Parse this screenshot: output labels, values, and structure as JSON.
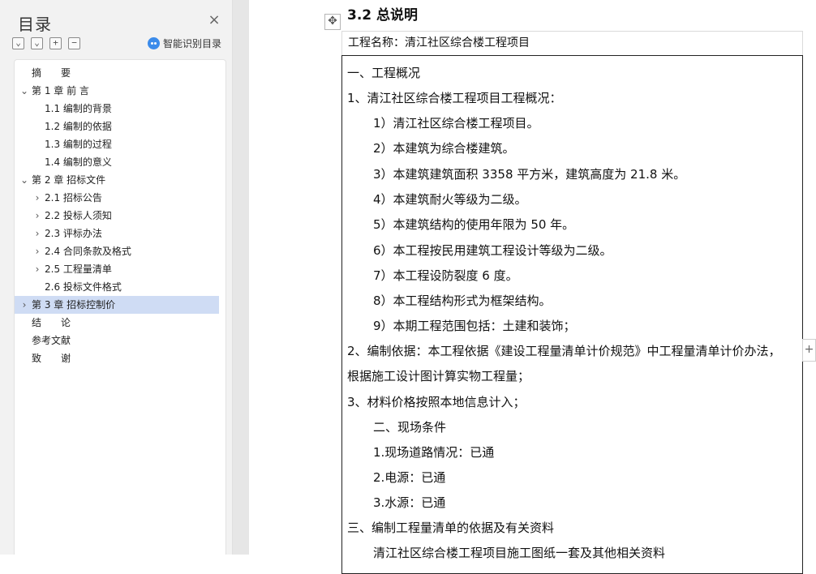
{
  "sidebar": {
    "title": "目录",
    "close_icon": "×",
    "toolbar": {
      "collapse_all": "⌄",
      "expand_all": "⌄",
      "add_level": "+",
      "remove_level": "−"
    },
    "smart_toc_label": "智能识别目录"
  },
  "outline": [
    {
      "label": "摘　　要",
      "level": 0,
      "chevron": ""
    },
    {
      "label": "第 1 章  前  言",
      "level": 0,
      "chevron": "⌄"
    },
    {
      "label": "1.1 编制的背景",
      "level": 1,
      "chevron": ""
    },
    {
      "label": "1.2 编制的依据",
      "level": 1,
      "chevron": ""
    },
    {
      "label": "1.3 编制的过程",
      "level": 1,
      "chevron": ""
    },
    {
      "label": "1.4 编制的意义",
      "level": 1,
      "chevron": ""
    },
    {
      "label": "第 2 章  招标文件",
      "level": 0,
      "chevron": "⌄"
    },
    {
      "label": "2.1  招标公告",
      "level": 1,
      "chevron": "›"
    },
    {
      "label": "2.2  投标人须知",
      "level": 1,
      "chevron": "›"
    },
    {
      "label": "2.3  评标办法",
      "level": 1,
      "chevron": "›"
    },
    {
      "label": "2.4  合同条款及格式",
      "level": 1,
      "chevron": "›"
    },
    {
      "label": "2.5 工程量清单",
      "level": 1,
      "chevron": "›"
    },
    {
      "label": "2.6  投标文件格式",
      "level": 1,
      "chevron": ""
    },
    {
      "label": "第 3 章  招标控制价",
      "level": 0,
      "chevron": "›",
      "selected": true
    },
    {
      "label": "结　　论",
      "level": 0,
      "chevron": ""
    },
    {
      "label": "参考文献",
      "level": 0,
      "chevron": ""
    },
    {
      "label": "致　　谢",
      "level": 0,
      "chevron": ""
    }
  ],
  "document": {
    "move_handle_icon": "✥",
    "heading": "3.2 总说明",
    "project_name": "工程名称：清江社区综合楼工程项目",
    "add_column_icon": "+",
    "lines": [
      {
        "text": "一、工程概况",
        "indent": 0
      },
      {
        "text": "1、清江社区综合楼工程项目工程概况：",
        "indent": 0
      },
      {
        "text": "1）清江社区综合楼工程项目。",
        "indent": 1
      },
      {
        "text": "2）本建筑为综合楼建筑。",
        "indent": 1
      },
      {
        "text": "3）本建筑建筑面积 3358 平方米，建筑高度为 21.8 米。",
        "indent": 1
      },
      {
        "text": "4）本建筑耐火等级为二级。",
        "indent": 1
      },
      {
        "text": "5）本建筑结构的使用年限为 50 年。",
        "indent": 1
      },
      {
        "text": "6）本工程按民用建筑工程设计等级为二级。",
        "indent": 1
      },
      {
        "text": "7）本工程设防裂度 6 度。",
        "indent": 1
      },
      {
        "text": "8）本工程结构形式为框架结构。",
        "indent": 1
      },
      {
        "text": "9）本期工程范围包括：土建和装饰；",
        "indent": 1
      },
      {
        "text": "2、编制依据：本工程依据《建设工程量清单计价规范》中工程量清单计价办法，",
        "indent": 0
      },
      {
        "text": "根据施工设计图计算实物工程量；",
        "indent": 0
      },
      {
        "text": "3、材料价格按照本地信息计入；",
        "indent": 0
      },
      {
        "text": "二、现场条件",
        "indent": 1
      },
      {
        "text": "1.现场道路情况：已通",
        "indent": 1
      },
      {
        "text": "2.电源：已通",
        "indent": 1
      },
      {
        "text": "3.水源：已通",
        "indent": 1
      },
      {
        "text": "三、编制工程量清单的依据及有关资料",
        "indent": 0
      },
      {
        "text": "清江社区综合楼工程项目施工图纸一套及其他相关资料",
        "indent": 1
      }
    ]
  }
}
